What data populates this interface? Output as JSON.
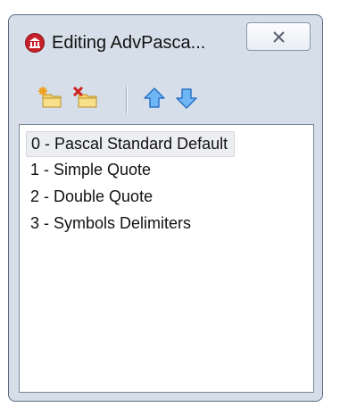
{
  "window": {
    "title": "Editing AdvPasca..."
  },
  "toolbar": {
    "buttons": [
      {
        "name": "new-item",
        "icon": "new-folder-star-icon"
      },
      {
        "name": "delete-item",
        "icon": "delete-folder-x-icon"
      },
      {
        "name": "move-up",
        "icon": "arrow-up-icon"
      },
      {
        "name": "move-down",
        "icon": "arrow-down-icon"
      }
    ]
  },
  "list": {
    "items": [
      {
        "label": "0 - Pascal Standard Default",
        "selected": true
      },
      {
        "label": "1 - Simple Quote",
        "selected": false
      },
      {
        "label": "2 - Double Quote",
        "selected": false
      },
      {
        "label": "3 - Symbols Delimiters",
        "selected": false
      }
    ]
  },
  "colors": {
    "frame": "#d6dfe9",
    "app_icon": "#c8202a",
    "arrow_blue": "#3d8ee0",
    "folder_yellow": "#f3d36b"
  }
}
